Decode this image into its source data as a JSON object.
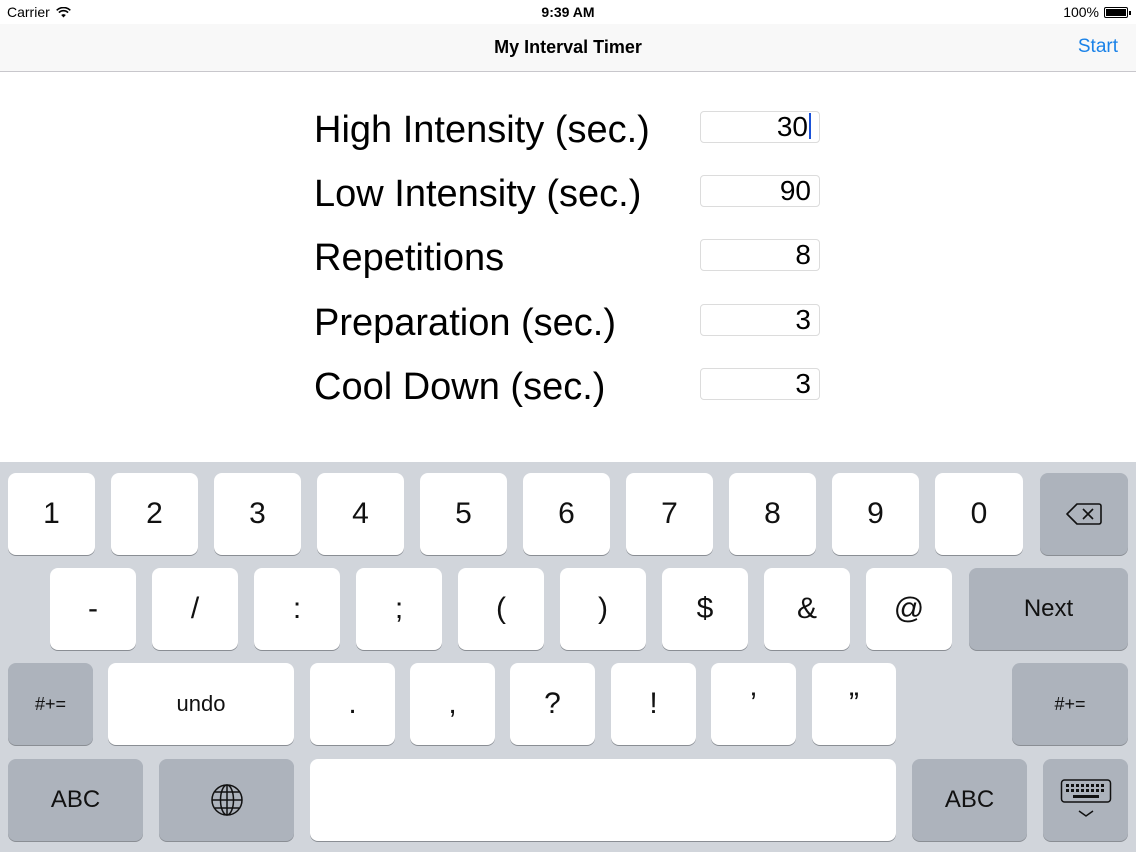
{
  "status": {
    "carrier": "Carrier",
    "time": "9:39 AM",
    "battery": "100%"
  },
  "nav": {
    "title": "My Interval Timer",
    "start": "Start"
  },
  "form": {
    "rows": [
      {
        "label": "High Intensity (sec.)",
        "value": "30"
      },
      {
        "label": "Low Intensity (sec.)",
        "value": "90"
      },
      {
        "label": "Repetitions",
        "value": "8"
      },
      {
        "label": "Preparation (sec.)",
        "value": "3"
      },
      {
        "label": "Cool Down (sec.)",
        "value": "3"
      }
    ]
  },
  "keyboard": {
    "row1": [
      "1",
      "2",
      "3",
      "4",
      "5",
      "6",
      "7",
      "8",
      "9",
      "0"
    ],
    "row2": [
      "-",
      "/",
      ":",
      ";",
      "(",
      ")",
      "$",
      "&",
      "@"
    ],
    "next": "Next",
    "row3": {
      "shift": "#+=",
      "undo": "undo",
      "keys": [
        ".",
        ",",
        "?",
        "!",
        "’",
        "”"
      ],
      "shift_right": "#+="
    },
    "row4": {
      "abc": "ABC",
      "abc_right": "ABC"
    }
  }
}
